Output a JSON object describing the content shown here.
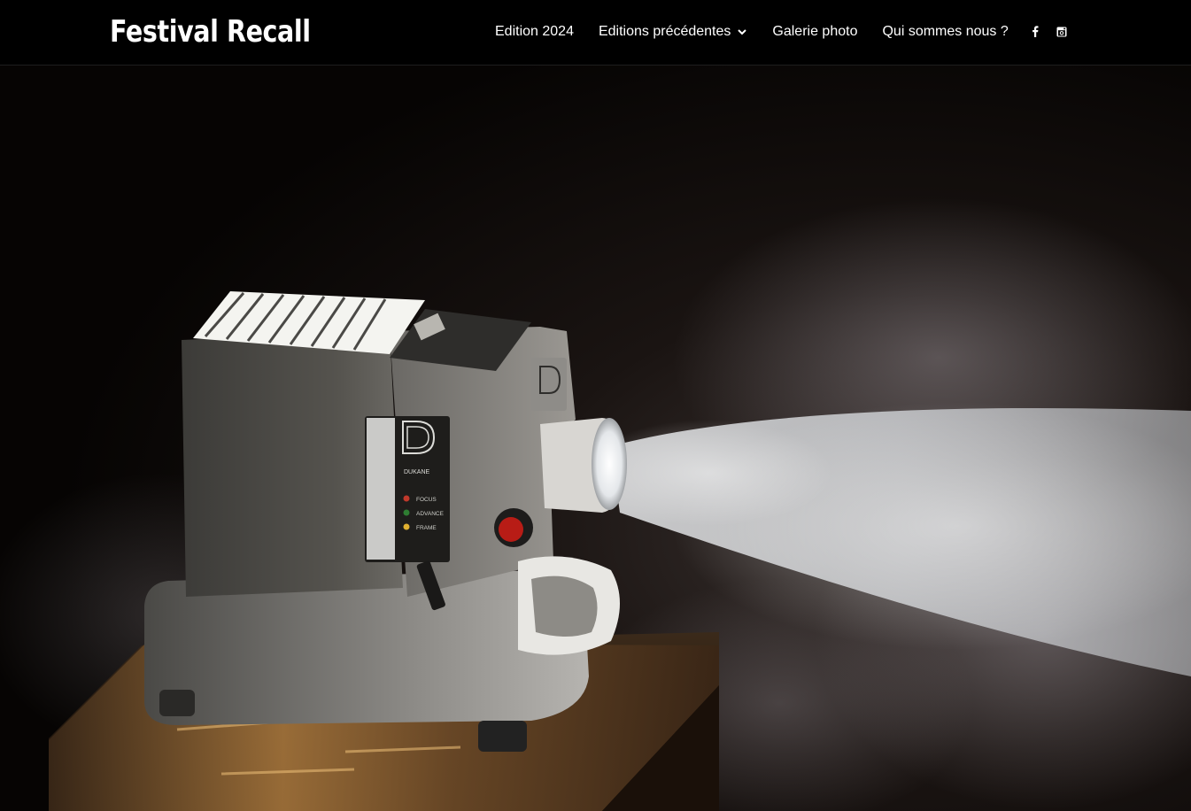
{
  "site": {
    "title": "Festival Recall"
  },
  "nav": {
    "items": [
      {
        "label": "Edition 2024"
      },
      {
        "label": "Editions précédentes",
        "has_dropdown": true,
        "icon": "chevron-down-icon"
      },
      {
        "label": "Galerie photo"
      },
      {
        "label": "Qui sommes nous ?"
      }
    ],
    "social": [
      {
        "icon": "facebook-icon"
      },
      {
        "icon": "instagram-icon"
      }
    ]
  },
  "hero": {
    "projector_brand": "DUKANE",
    "controls": [
      "FOCUS",
      "ADVANCE",
      "FRAME"
    ],
    "colors": {
      "background": "#0a0706",
      "beam": "#e8ecef",
      "box": "#6b4a2a",
      "projector_body": "#4a4945"
    }
  }
}
